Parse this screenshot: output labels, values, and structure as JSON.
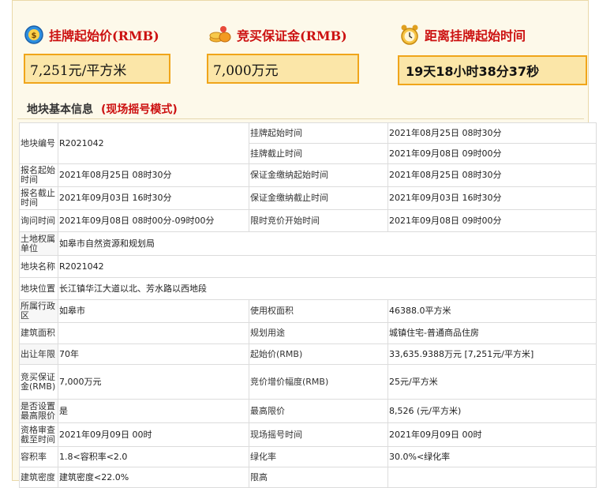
{
  "header": {
    "start_price_title": "挂牌起始价(RMB)",
    "deposit_title": "竞买保证金(RMB)",
    "countdown_title": "距离挂牌起始时间",
    "start_price_value": "7,251元/平方米",
    "deposit_value": "7,000万元",
    "countdown_value": "19天18小时38分37秒"
  },
  "section": {
    "title": "地块基本信息",
    "mode": "(现场摇号模式)"
  },
  "table": {
    "parcel_no_label": "地块编号",
    "parcel_no": "R2021042",
    "listing_start_label": "挂牌起始时间",
    "listing_start": "2021年08月25日 08时30分",
    "listing_end_label": "挂牌截止时间",
    "listing_end": "2021年09月08日 09时00分",
    "reg_start_label": "报名起始时间",
    "reg_start": "2021年08月25日 08时30分",
    "deposit_start_label": "保证金缴纳起始时间",
    "deposit_start": "2021年08月25日 08时30分",
    "reg_end_label": "报名截止时间",
    "reg_end": "2021年09月03日 16时30分",
    "deposit_end_label": "保证金缴纳截止时间",
    "deposit_end": "2021年09月03日 16时30分",
    "inquiry_label": "询问时间",
    "inquiry": "2021年09月08日 08时00分-09时00分",
    "bid_start_label": "限时竞价开始时间",
    "bid_start": "2021年09月08日 09时00分",
    "owner_label": "土地权属单位",
    "owner": "如皋市自然资源和规划局",
    "name_label": "地块名称",
    "name": "R2021042",
    "location_label": "地块位置",
    "location": "长江镇华江大道以北、芳水路以西地段",
    "district_label": "所属行政区",
    "district": "如皋市",
    "use_area_label": "使用权面积",
    "use_area": "46388.0平方米",
    "build_area_label": "建筑面积",
    "build_area": "",
    "planned_use_label": "规划用途",
    "planned_use": "城镇住宅-普通商品住房",
    "term_label": "出让年限",
    "term": "70年",
    "start_price_label": "起始价(RMB)",
    "start_price": "33,635.9388万元 [7,251元/平方米]",
    "deposit_label": "竞买保证金(RMB)",
    "deposit": "7,000万元",
    "increment_label": "竞价增价幅度(RMB)",
    "increment": "25元/平方米",
    "limit_flag_label": "是否设置最高限价",
    "limit_flag": "是",
    "max_price_label": "最高限价",
    "max_price": "8,526 (元/平方米)",
    "review_end_label": "资格审查截至时间",
    "review_end": "2021年09月09日 00时",
    "lottery_label": "现场摇号时间",
    "lottery": "2021年09月09日 00时",
    "far_label": "容积率",
    "far": "1.8<容积率<2.0",
    "green_label": "绿化率",
    "green": "30.0%<绿化率",
    "density_label": "建筑密度",
    "density": "建筑密度<22.0%",
    "height_label": "限高",
    "height": ""
  },
  "colors": {
    "accent_red": "#cc1111",
    "box_border": "#f0a51a",
    "box_fill": "#fbe6a8"
  }
}
